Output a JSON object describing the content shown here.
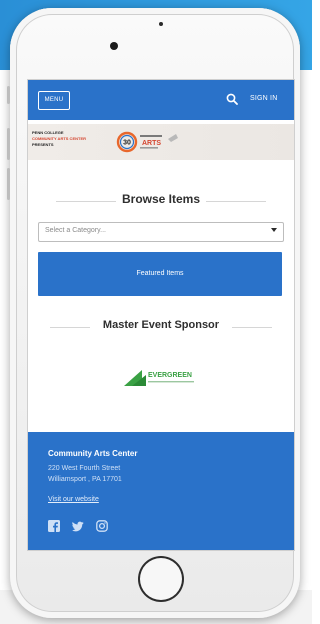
{
  "screen": {
    "appbar": {
      "menu_label": "MENU",
      "signin_label": "SIGN IN"
    },
    "promo": {
      "line1": "PENN COLLEGE",
      "line2": "COMMUNITY ARTS CENTER",
      "line3": "PRESENTS",
      "logo_number": "30",
      "logo_text": "ARTS"
    },
    "browse": {
      "title": "Browse Items",
      "select_placeholder": "Select a Category...",
      "featured_label": "Featured Items"
    },
    "sponsor": {
      "title": "Master Event Sponsor",
      "logo_text": "EVERGREEN"
    },
    "footer": {
      "name": "Community Arts Center",
      "address_line1": "220 West Fourth Street",
      "address_line2": "Williamsport , PA 17701",
      "website_link": "Visit our website"
    }
  },
  "colors": {
    "brand_blue": "#2a72c9",
    "background_blue": "#2a8fd6",
    "sponsor_green": "#3aa144"
  },
  "icons": [
    "search-icon",
    "facebook-icon",
    "twitter-icon",
    "instagram-icon"
  ]
}
